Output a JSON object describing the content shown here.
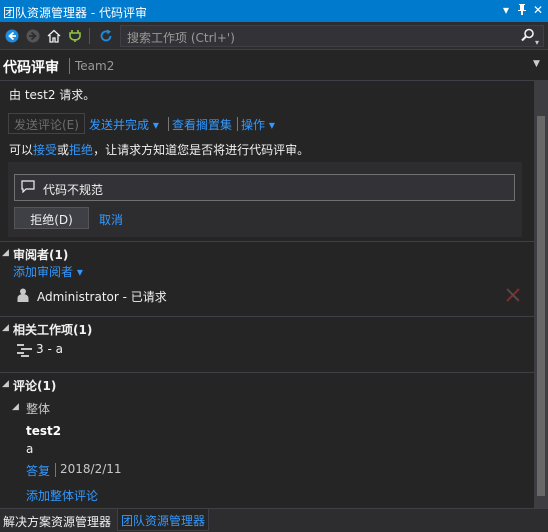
{
  "window": {
    "title": "团队资源管理器 - 代码评审",
    "pin_glyph": "▾",
    "pushpin_glyph": "⊓",
    "close_glyph": "✕"
  },
  "toolbar": {
    "search_placeholder": "搜索工作项 (Ctrl+')",
    "search_icon_glyph": "⌕"
  },
  "header": {
    "title": "代码评审",
    "team": "Team2",
    "menu_glyph": "▼"
  },
  "request": {
    "text": "由 test2 请求。",
    "send_comments_label": "发送评论(E)",
    "send_and_complete_label": "发送并完成 ▾",
    "view_shelveset_label": "查看搁置集",
    "actions_label": "操作 ▾",
    "accept_prefix": "可以",
    "accept_label": "接受",
    "or_text": "或",
    "decline_label": "拒绝",
    "accept_suffix": "，让请求方知道您是否将进行代码评审。"
  },
  "reject_panel": {
    "reason_value": "代码不规范",
    "reject_button_label": "拒绝(D)",
    "cancel_label": "取消"
  },
  "reviewers": {
    "title": "审阅者(1)",
    "add_label": "添加审阅者 ▾",
    "items": [
      {
        "name": "Administrator - 已请求"
      }
    ]
  },
  "work_items": {
    "title": "相关工作项(1)",
    "items": [
      {
        "label": "3 - a"
      }
    ]
  },
  "comments": {
    "title": "评论(1)",
    "group_label": "整体",
    "author": "test2",
    "body": "a",
    "reply_label": "答复",
    "date": "2018/2/11",
    "add_overall_label": "添加整体评论"
  },
  "tabs": [
    {
      "label": "解决方案资源管理器"
    },
    {
      "label": "团队资源管理器"
    }
  ],
  "colors": {
    "accent": "#007acc",
    "link": "#3399ff",
    "background": "#252526"
  }
}
